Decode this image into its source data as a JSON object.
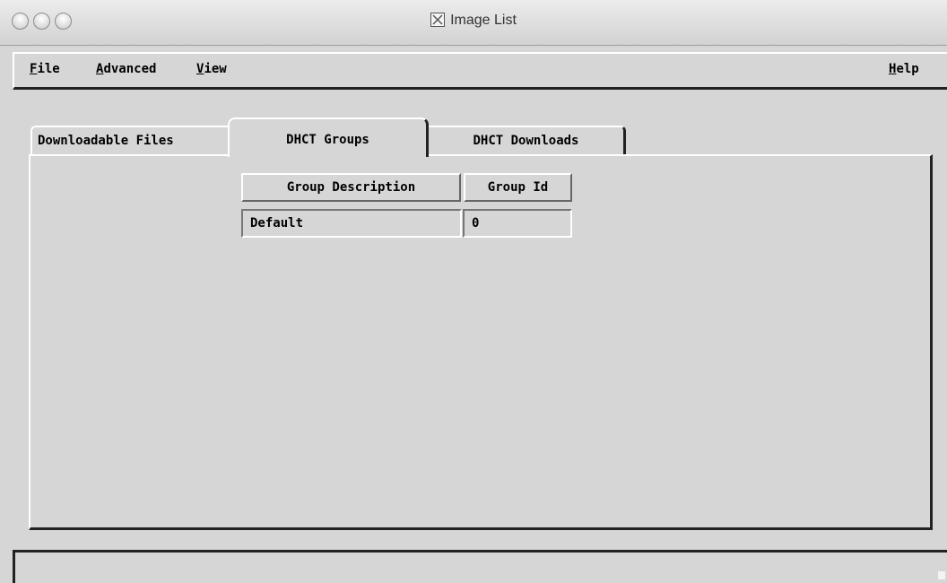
{
  "window": {
    "title": "Image List"
  },
  "menu": {
    "file": "File",
    "file_mnemonic": "F",
    "file_rest": "ile",
    "advanced_mnemonic": "A",
    "advanced_rest": "dvanced",
    "view_mnemonic": "V",
    "view_rest": "iew",
    "help_mnemonic": "H",
    "help_rest": "elp"
  },
  "tabs": [
    {
      "label": "Downloadable Files",
      "selected": false
    },
    {
      "label": "DHCT Groups",
      "selected": true
    },
    {
      "label": "DHCT Downloads",
      "selected": false
    }
  ],
  "table": {
    "columns": [
      "Group Description",
      "Group Id"
    ],
    "rows": [
      [
        "Default",
        "0"
      ]
    ]
  },
  "icons": {
    "title_icon": "x11-icon"
  },
  "colors": {
    "background": "#d6d6d6",
    "border_dark": "#222222",
    "border_light": "#ffffff"
  }
}
